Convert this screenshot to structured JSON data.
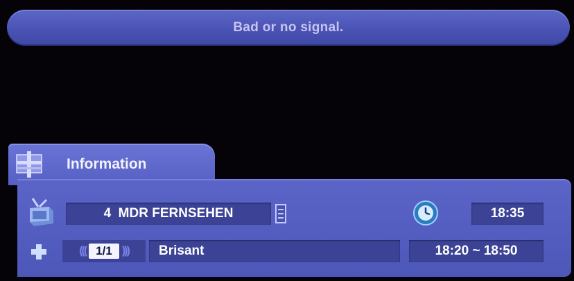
{
  "signal": {
    "message": "Bad or no signal."
  },
  "info_panel": {
    "title": "Information",
    "tab_icon": "settings-grid-icon",
    "channel": {
      "number": "4",
      "name": "MDR FERNSEHEN",
      "display": "4  MDR FERNSEHEN",
      "tv_icon": "tv-icon",
      "list_icon": "list-icon"
    },
    "clock": {
      "icon": "clock-icon",
      "time": "18:35"
    },
    "program": {
      "icon": "plus-icon",
      "audio_track": "1/1",
      "title": "Brisant",
      "time_range": "18:20 ~ 18:50"
    }
  },
  "colors": {
    "panel": "#5660c2",
    "field": "#3c4396",
    "text": "#ffffff",
    "banner_text": "#c8c2ef"
  }
}
